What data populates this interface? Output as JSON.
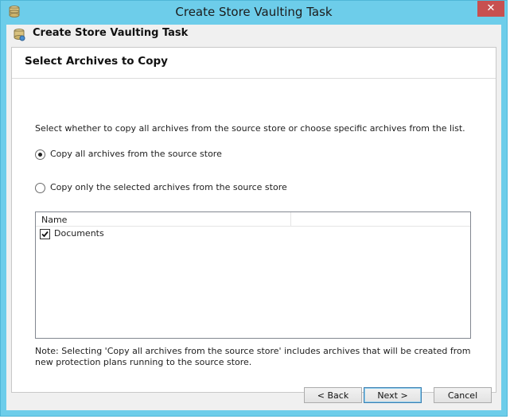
{
  "window": {
    "title": "Create Store Vaulting Task",
    "close_label": "✕"
  },
  "header": {
    "title": "Create Store Vaulting Task"
  },
  "page": {
    "title": "Select Archives to Copy",
    "instruction": "Select whether to copy all archives from the source store or choose specific archives from the list.",
    "options": [
      {
        "label": "Copy all archives from the source store",
        "selected": true
      },
      {
        "label": "Copy only the selected archives from the source store",
        "selected": false
      }
    ],
    "list": {
      "columns": [
        "Name"
      ],
      "rows": [
        {
          "name": "Documents",
          "checked": true
        }
      ]
    },
    "note": "Note: Selecting 'Copy all archives from the source store' includes archives that will be created from new protection plans running to the source store."
  },
  "buttons": {
    "back": "< Back",
    "next": "Next >",
    "cancel": "Cancel"
  }
}
